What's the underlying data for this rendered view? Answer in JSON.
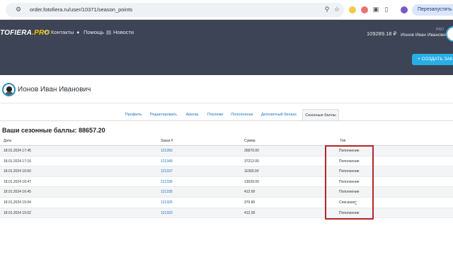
{
  "browser": {
    "url": "order.fotofiera.ru/user/10371/season_points",
    "relaunch_label": "Перезапустить и обнов"
  },
  "header": {
    "logo_main": "TOFIERA",
    "logo_suffix": ".PRO",
    "nav": [
      {
        "label": "Контакты",
        "icon": "phone-icon"
      },
      {
        "label": "Помощь",
        "icon": "help-icon"
      },
      {
        "label": "Новости",
        "icon": "news-icon"
      }
    ],
    "balance": "109289.18 ₽",
    "pro_badge": "PRO",
    "user_name": "Ионов Иван Иванович",
    "create_button": "+ СОЗДАТЬ ЗАКАЗ"
  },
  "profile": {
    "name": "Ионов Иван Иванович"
  },
  "tabs": [
    {
      "label": "Профиль",
      "active": false
    },
    {
      "label": "Редактировать",
      "active": false
    },
    {
      "label": "Аватар",
      "active": false
    },
    {
      "label": "Платежи",
      "active": false
    },
    {
      "label": "Пополнение",
      "active": false
    },
    {
      "label": "Депозитный баланс",
      "active": false
    },
    {
      "label": "Сезонные баллы",
      "active": true
    }
  ],
  "page": {
    "title": "Ваши сезонные баллы: 88657.20"
  },
  "table": {
    "columns": [
      "Дата",
      "Заказ #",
      "Сумма",
      "Тип"
    ],
    "rows": [
      {
        "date": "18.01.2024 17:45",
        "order": "121350",
        "amount": "26870.00",
        "type": "Пополнение"
      },
      {
        "date": "18.01.2024 17:16",
        "order": "121349",
        "amount": "37212.00",
        "type": "Пополнение"
      },
      {
        "date": "18.01.2024 16:50",
        "order": "121337",
        "amount": "11093.00",
        "type": "Пополнение"
      },
      {
        "date": "18.01.2024 16:47",
        "order": "121336",
        "amount": "13029.00",
        "type": "Пополнение"
      },
      {
        "date": "18.01.2024 16:45",
        "order": "121335",
        "amount": "412.00",
        "type": "Пополнение"
      },
      {
        "date": "18.01.2024 15:04",
        "order": "121325",
        "amount": "370.80",
        "type": "Списание"
      },
      {
        "date": "18.01.2024 15:02",
        "order": "121323",
        "amount": "412.00",
        "type": "Пополнение"
      }
    ]
  },
  "colors": {
    "header_bg": "#3c4455",
    "accent": "#27aee6",
    "link": "#1e73be",
    "highlight": "#b3262d"
  }
}
